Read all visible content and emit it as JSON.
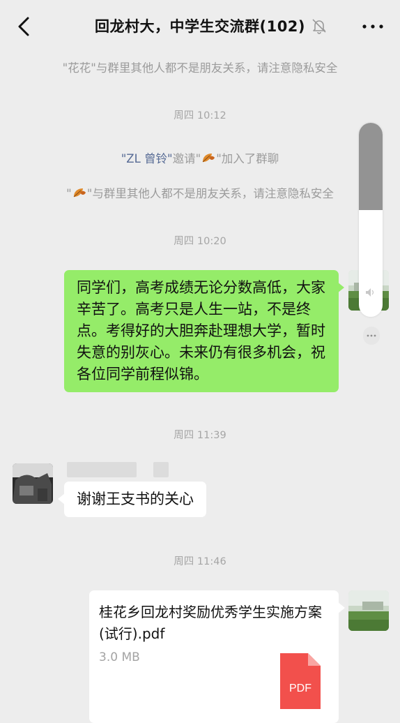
{
  "header": {
    "title": "回龙村大，中学生交流群",
    "member_count": "(102)"
  },
  "system_messages": {
    "privacy_1": "\"花花\"与群里其他人都不是朋友关系，请注意隐私安全",
    "invite_inviter": "\"ZL 曾铃\"",
    "invite_text": "邀请\"",
    "invite_tail": "\"加入了群聊",
    "privacy_2_prefix": "\"",
    "privacy_2_text": "\"与群里其他人都不是朋友关系，请注意隐私安全"
  },
  "timestamps": [
    "周四 10:12",
    "周四 10:20",
    "周四 11:39",
    "周四 11:46"
  ],
  "messages": {
    "greeting": "同学们，高考成绩无论分数高低，大家辛苦了。高考只是人生一站，不是终点。考得好的大胆奔赴理想大学，暂时失意的别灰心。未来仍有很多机会，祝各位同学前程似锦。",
    "reply": "谢谢王支书的关心"
  },
  "file": {
    "name": "桂花乡回龙村奖励优秀学生实施方案(试行).pdf",
    "size": "3.0 MB",
    "type_label": "PDF"
  },
  "volume_level": 0.45,
  "colors": {
    "background": "#ededed",
    "sent_bubble": "#95ec69",
    "received_bubble": "#ffffff",
    "link": "#576b95",
    "pdf_icon": "#f2504c"
  },
  "icons": [
    "back-chevron-icon",
    "mute-bell-icon",
    "more-dots-icon",
    "leaf-icon",
    "pdf-file-icon"
  ]
}
